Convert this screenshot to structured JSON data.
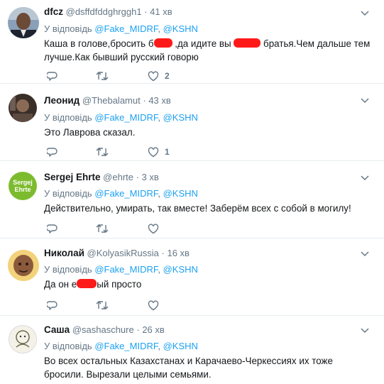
{
  "reply_prefix": "У відповідь",
  "tweets": [
    {
      "name": "dfcz",
      "handle": "@dsffdfddghrggh1",
      "dot": "·",
      "time": "41 хв",
      "reply_to": [
        "@Fake_MIDRF",
        "@KSHN"
      ],
      "text_parts": [
        "Каша в голове,бросить б",
        " ,да идите вы ",
        " братья.Чем дальше тем лучше.Как бывший русский говорю"
      ],
      "reply_count": "",
      "retweet_count": "",
      "like_count": "2"
    },
    {
      "name": "Леонид",
      "handle": "@Thebalamut",
      "dot": "·",
      "time": "43 хв",
      "reply_to": [
        "@Fake_MIDRF",
        "@KSHN"
      ],
      "text": "Это Лаврова сказал.",
      "reply_count": "",
      "retweet_count": "",
      "like_count": "1"
    },
    {
      "name": "Sergej Ehrte",
      "handle": "@ehrte",
      "dot": "·",
      "time": "3 хв",
      "avatar_text": [
        "Sergej",
        "Ehrte"
      ],
      "reply_to": [
        "@Fake_MIDRF",
        "@KSHN"
      ],
      "text": "Действительно, умирать, так вместе! Заберём всех с собой в могилу!",
      "reply_count": "",
      "retweet_count": "",
      "like_count": ""
    },
    {
      "name": "Николай",
      "handle": "@KolyasikRussia",
      "dot": "·",
      "time": "16 хв",
      "reply_to": [
        "@Fake_MIDRF",
        "@KSHN"
      ],
      "text_parts": [
        "Да он е",
        "ый просто"
      ],
      "reply_count": "",
      "retweet_count": "",
      "like_count": ""
    },
    {
      "name": "Саша",
      "handle": "@sashaschure",
      "dot": "·",
      "time": "26 хв",
      "reply_to": [
        "@Fake_MIDRF",
        "@KSHN"
      ],
      "text": "Во всех остальных Казахстанах и Карачаево-Черкессиях их тоже бросили. Вырезали целыми семьями.",
      "reply_count": "",
      "retweet_count": "",
      "like_count": ""
    }
  ],
  "colors": {
    "link": "#1da1f2",
    "muted": "#657786",
    "text": "#14171a",
    "divider": "#e6ecf0",
    "redaction": "#ff1a1a",
    "sergej_avatar_bg": "#7dbb2e"
  },
  "icons": [
    "reply-icon",
    "retweet-icon",
    "like-icon",
    "chevron-down-icon"
  ]
}
